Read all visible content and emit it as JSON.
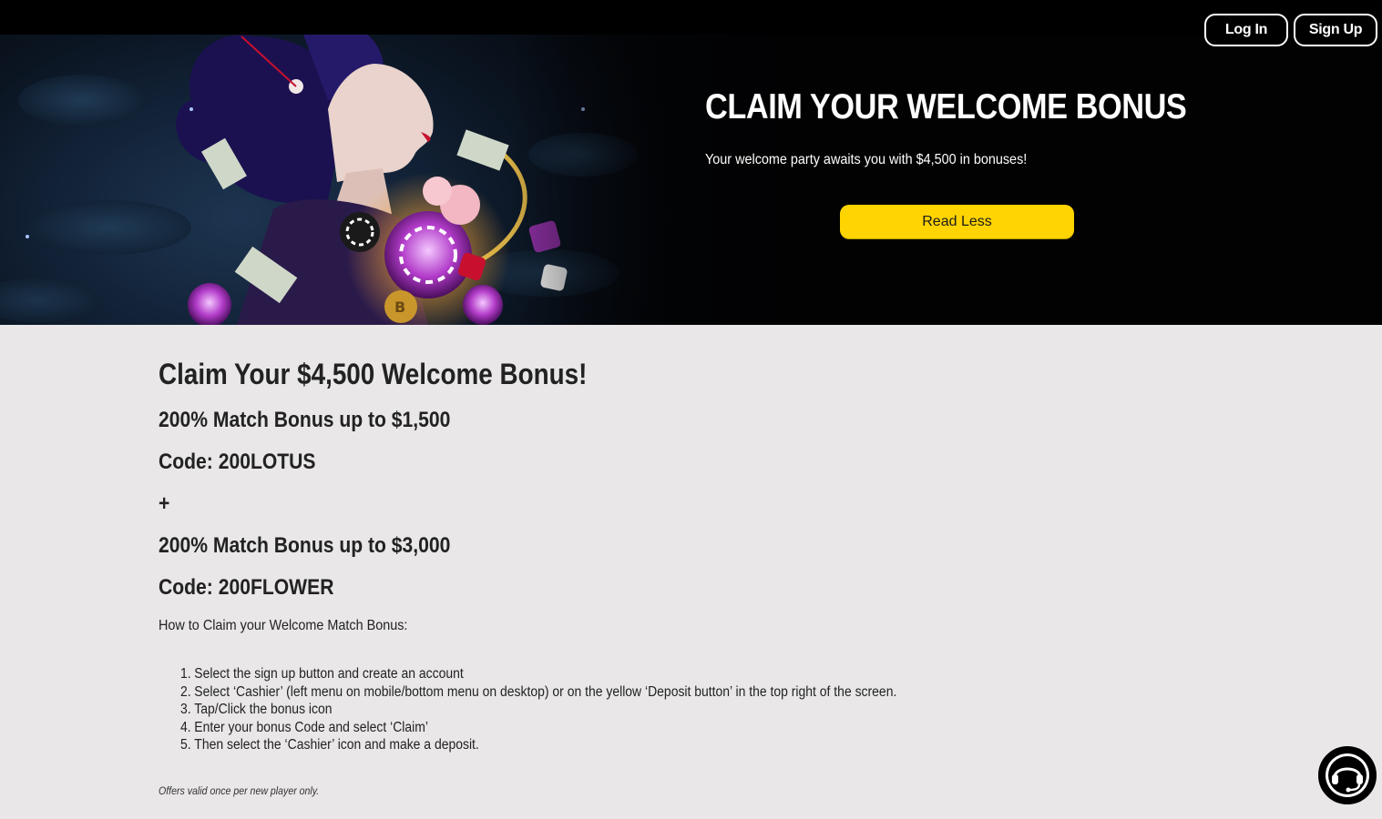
{
  "header": {
    "login_label": "Log In",
    "signup_label": "Sign Up"
  },
  "hero": {
    "title": "CLAIM YOUR WELCOME BONUS",
    "subtitle": "Your welcome party awaits you with $4,500 in bonuses!",
    "toggle_button_label": "Read Less",
    "accent_color": "#ffd400"
  },
  "content": {
    "heading": "Claim Your $4,500 Welcome Bonus!",
    "offers": [
      "200% Match Bonus up to $1,500",
      "Code: 200LOTUS",
      "+",
      "200% Match Bonus up to $3,000",
      "Code: 200FLOWER"
    ],
    "how_to_label": "How to Claim your Welcome Match Bonus:",
    "steps": [
      {
        "num": "1.",
        "text": "Select the sign up button and create an account"
      },
      {
        "num": "2.",
        "text": "Select ‘Cashier’ (left menu on mobile/bottom menu on desktop) or on the yellow ‘Deposit button’ in the top right of the screen."
      },
      {
        "num": "3.",
        "text": "Tap/Click the bonus icon"
      },
      {
        "num": "4.",
        "text": "Enter your bonus Code and select ‘Claim’"
      },
      {
        "num": "5.",
        "text": "Then select the ‘Cashier’ icon and make a deposit."
      }
    ],
    "disclaimer": "Offers valid once per new player only."
  },
  "chat": {
    "icon": "headset-chat-icon"
  }
}
